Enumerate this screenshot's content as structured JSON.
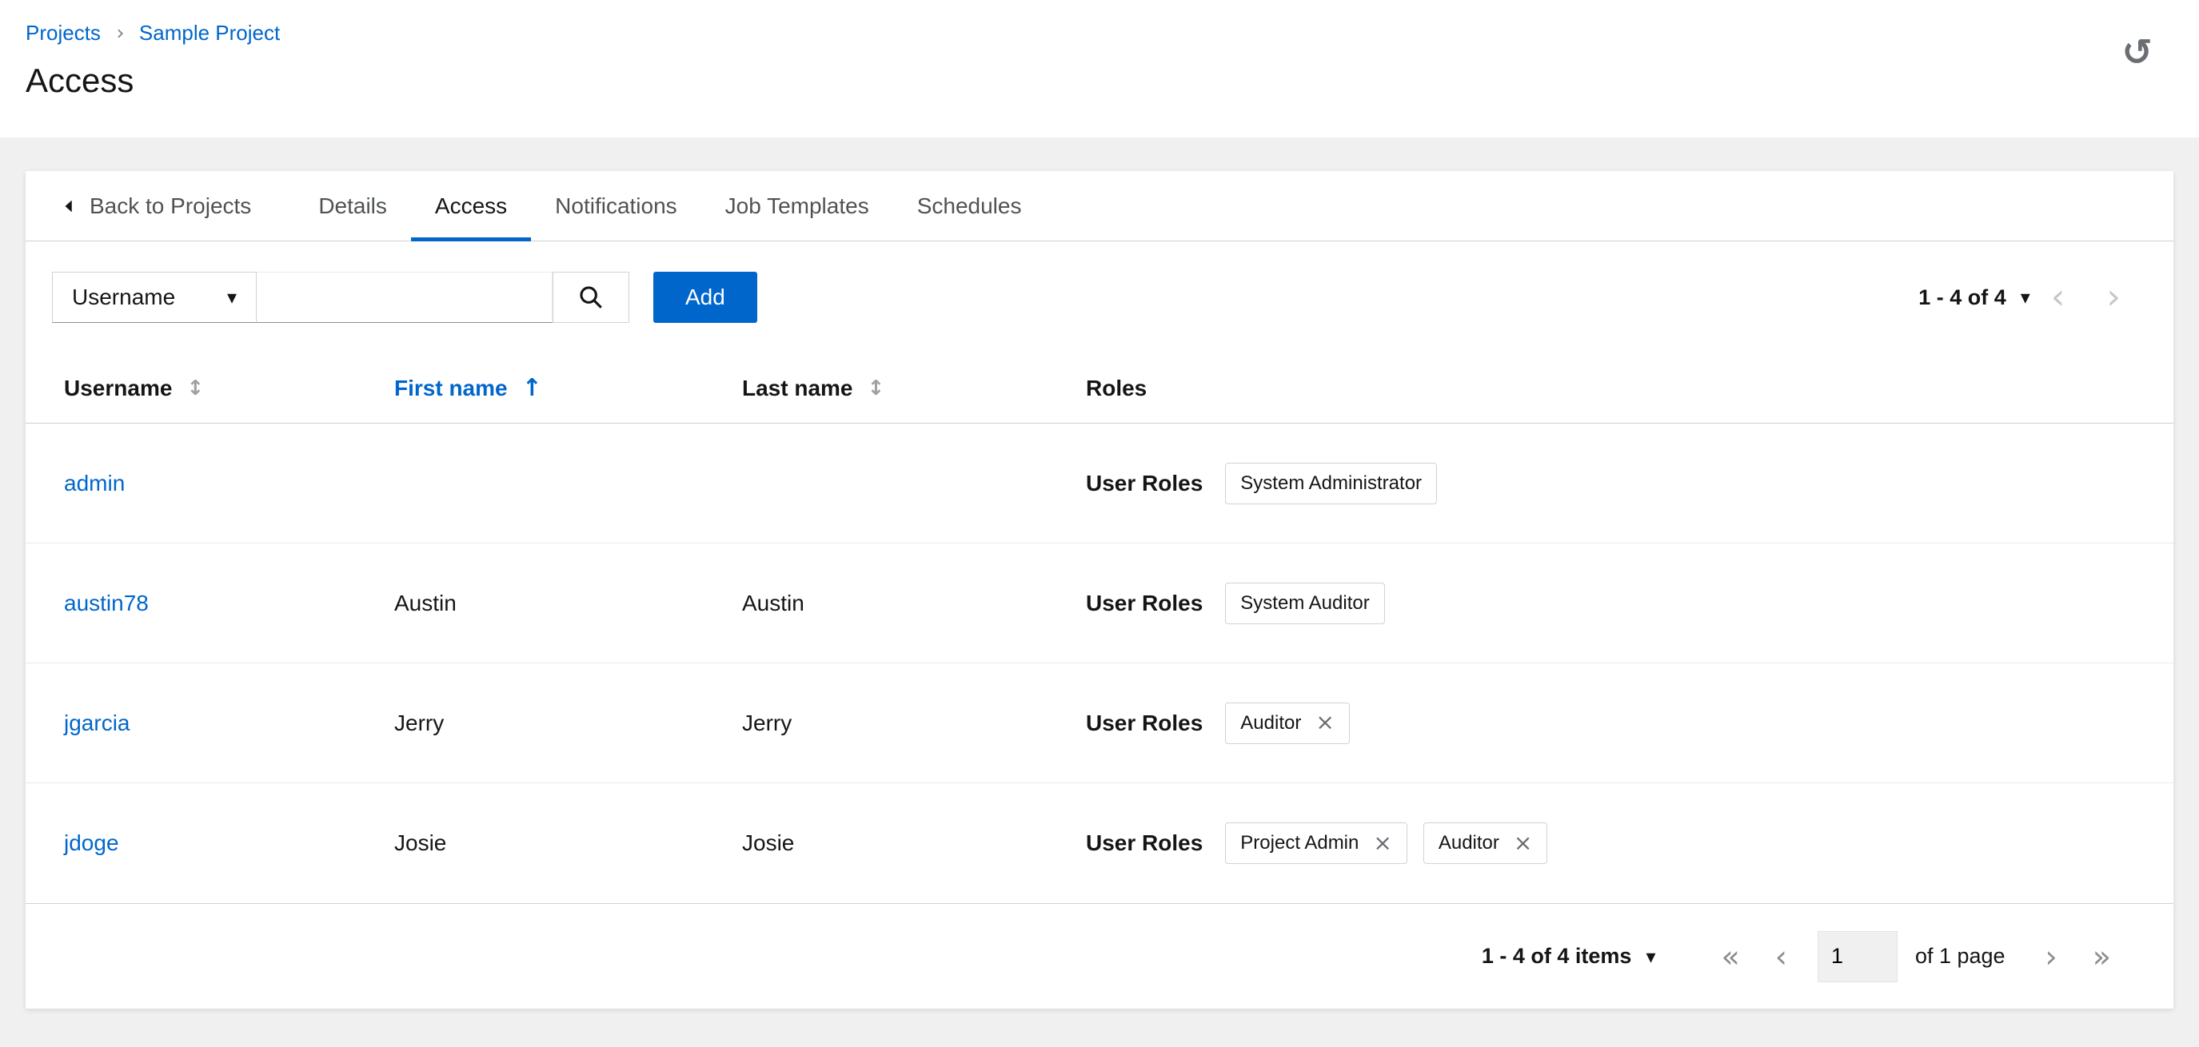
{
  "colors": {
    "accent": "#0066cc",
    "background": "#f0f0f0"
  },
  "breadcrumb": {
    "items": [
      {
        "label": "Projects"
      },
      {
        "label": "Sample Project"
      }
    ]
  },
  "page": {
    "title": "Access"
  },
  "tabs": {
    "back_label": "Back to Projects",
    "items": [
      {
        "label": "Details",
        "active": false
      },
      {
        "label": "Access",
        "active": true
      },
      {
        "label": "Notifications",
        "active": false
      },
      {
        "label": "Job Templates",
        "active": false
      },
      {
        "label": "Schedules",
        "active": false
      }
    ]
  },
  "toolbar": {
    "filter_dropdown": "Username",
    "search_value": "",
    "search_placeholder": "",
    "add_label": "Add",
    "pagination_summary": "1 - 4 of 4"
  },
  "table": {
    "columns": [
      "Username",
      "First name",
      "Last name",
      "Roles"
    ],
    "sorted_column": "First name",
    "sort_direction": "ascending",
    "roles_label": "User Roles",
    "rows": [
      {
        "username": "admin",
        "first": "",
        "last": "",
        "chips": [
          {
            "label": "System Administrator",
            "removable": false
          }
        ]
      },
      {
        "username": "austin78",
        "first": "Austin",
        "last": "Austin",
        "chips": [
          {
            "label": "System Auditor",
            "removable": false
          }
        ]
      },
      {
        "username": "jgarcia",
        "first": "Jerry",
        "last": "Jerry",
        "chips": [
          {
            "label": "Auditor",
            "removable": true
          }
        ]
      },
      {
        "username": "jdoge",
        "first": "Josie",
        "last": "Josie",
        "chips": [
          {
            "label": "Project Admin",
            "removable": true
          },
          {
            "label": "Auditor",
            "removable": true
          }
        ]
      }
    ]
  },
  "footer": {
    "items_summary": "1 - 4 of 4 items",
    "current_page": "1",
    "page_label": "of 1 page"
  },
  "icons": {
    "history": "↺",
    "caret_down": "▾",
    "sort_inactive": "↕",
    "sort_ascending": "↑",
    "close": "×",
    "prev": "‹",
    "next": "›",
    "first": "«",
    "last": "»"
  }
}
